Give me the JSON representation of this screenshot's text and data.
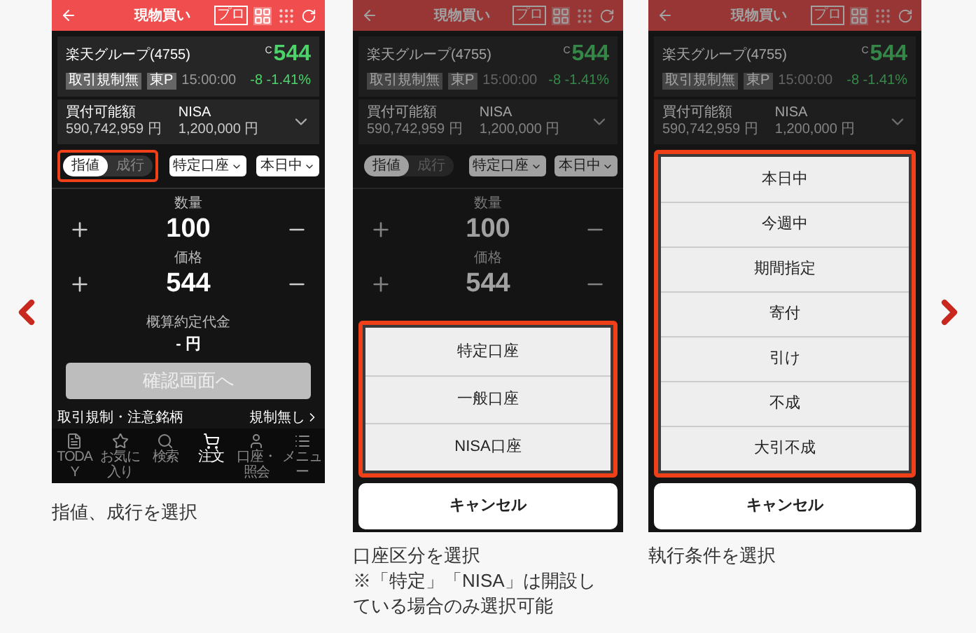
{
  "panels": [
    {
      "dimmed": false,
      "header": {
        "title": "現物買い",
        "pro_label": "プロ"
      },
      "stock": {
        "name": "楽天グループ(4755)",
        "price_prefix": "C",
        "price": "544",
        "tags": [
          "取引規制無",
          "東P"
        ],
        "time": "15:00:00",
        "change": "-8 -1.41%"
      },
      "account": [
        {
          "label": "買付可能額",
          "value": "590,742,959 円"
        },
        {
          "label": "NISA",
          "value": "1,200,000 円"
        }
      ],
      "controls": {
        "order_types": {
          "highlighted": true,
          "options": [
            {
              "label": "指値",
              "selected": true
            },
            {
              "label": "成行",
              "selected": false
            }
          ]
        },
        "dropdowns": [
          "特定口座",
          "本日中"
        ]
      },
      "quantity": {
        "label": "数量",
        "value": "100"
      },
      "price": {
        "label": "価格",
        "value": "544"
      },
      "estimate": {
        "label": "概算約定代金",
        "value": "- 円"
      },
      "confirm_button": {
        "label": "確認画面へ",
        "disabled": true
      },
      "regulation": {
        "label": "取引規制・注意銘柄",
        "value": "規制無し"
      },
      "bottom_nav": [
        {
          "label": "TODAY",
          "selected": false
        },
        {
          "label": "お気に入り",
          "selected": false
        },
        {
          "label": "検索",
          "selected": false
        },
        {
          "label": "注文",
          "selected": true
        },
        {
          "label": "口座・照会",
          "selected": false
        },
        {
          "label": "メニュー",
          "selected": false
        }
      ],
      "caption": [
        "指値、成行を選択"
      ]
    },
    {
      "dimmed": true,
      "header": {
        "title": "現物買い",
        "pro_label": "プロ"
      },
      "stock": {
        "name": "楽天グループ(4755)",
        "price_prefix": "C",
        "price": "544",
        "tags": [
          "取引規制無",
          "東P"
        ],
        "time": "15:00:00",
        "change": "-8 -1.41%"
      },
      "account": [
        {
          "label": "買付可能額",
          "value": "590,742,959 円"
        },
        {
          "label": "NISA",
          "value": "1,200,000 円"
        }
      ],
      "controls": {
        "order_types": {
          "highlighted": false,
          "options": [
            {
              "label": "指値",
              "selected": true
            },
            {
              "label": "成行",
              "selected": false
            }
          ]
        },
        "dropdowns": [
          "特定口座",
          "本日中"
        ]
      },
      "quantity": {
        "label": "数量",
        "value": "100"
      },
      "price": {
        "label": "価格",
        "value": "544"
      },
      "sheet": {
        "options": [
          "特定口座",
          "一般口座",
          "NISA口座"
        ],
        "cancel": "キャンセル"
      },
      "caption": [
        "口座区分を選択",
        "※「特定」「NISA」は開設し",
        "ている場合のみ選択可能"
      ]
    },
    {
      "dimmed": true,
      "header": {
        "title": "現物買い",
        "pro_label": "プロ"
      },
      "stock": {
        "name": "楽天グループ(4755)",
        "price_prefix": "C",
        "price": "544",
        "tags": [
          "取引規制無",
          "東P"
        ],
        "time": "15:00:00",
        "change": "-8 -1.41%"
      },
      "account": [
        {
          "label": "買付可能額",
          "value": "590,742,959 円"
        },
        {
          "label": "NISA",
          "value": "1,200,000 円"
        }
      ],
      "sheet": {
        "options": [
          "本日中",
          "今週中",
          "期間指定",
          "寄付",
          "引け",
          "不成",
          "大引不成"
        ],
        "cancel": "キャンセル"
      },
      "caption": [
        "執行条件を選択"
      ]
    }
  ]
}
